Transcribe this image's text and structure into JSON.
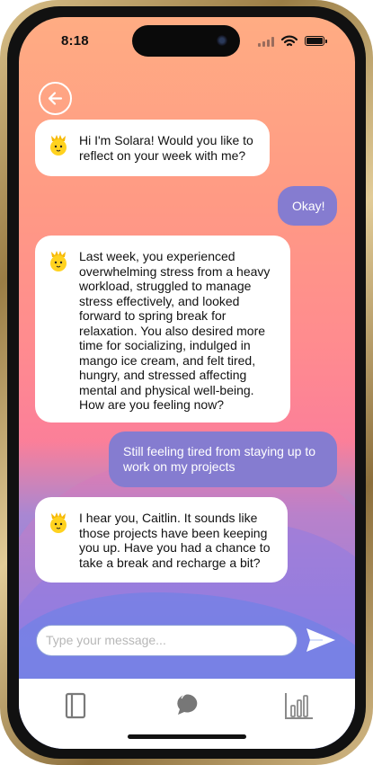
{
  "status_bar": {
    "time": "8:18"
  },
  "colors": {
    "user_bubble": "#857cd0",
    "bot_bubble": "#ffffff",
    "background_top": "#ffac83",
    "background_bottom": "#5f8aee",
    "send_icon": "#ffffff"
  },
  "navigation": {
    "back_icon": "arrow-left-circle-icon"
  },
  "messages": [
    {
      "sender": "bot",
      "avatar_icon": "sun-face-icon",
      "lines": [
        "Hi I'm Solara! Would you like to",
        "reflect on your week with me?"
      ]
    },
    {
      "sender": "user",
      "lines": [
        "Okay!"
      ]
    },
    {
      "sender": "bot",
      "avatar_icon": "sun-face-icon",
      "lines": [
        "Last week, you experienced",
        "overwhelming stress from a heavy",
        "workload, struggled to manage",
        "stress effectively, and looked",
        "forward to spring break for",
        "relaxation. You also desired more",
        "time for socializing, indulged in",
        "mango ice cream, and felt tired,",
        "hungry, and stressed affecting",
        "mental and physical well-being.",
        "How are you feeling now?"
      ]
    },
    {
      "sender": "user",
      "lines": [
        "Still feeling tired from staying up to",
        "work on my projects"
      ]
    },
    {
      "sender": "bot",
      "avatar_icon": "sun-face-icon",
      "lines": [
        "I hear you, Caitlin. It sounds like",
        "those projects have been keeping",
        "you up. Have you had a chance to",
        "take a break and recharge a bit?"
      ]
    }
  ],
  "composer": {
    "placeholder": "Type your message...",
    "value": "",
    "send_icon": "send-arrow-icon"
  },
  "tab_bar": {
    "tabs": [
      {
        "id": "journal",
        "icon": "journal-book-icon"
      },
      {
        "id": "chat",
        "icon": "chat-bubbles-icon",
        "active": true
      },
      {
        "id": "insights",
        "icon": "bar-chart-icon"
      }
    ]
  }
}
